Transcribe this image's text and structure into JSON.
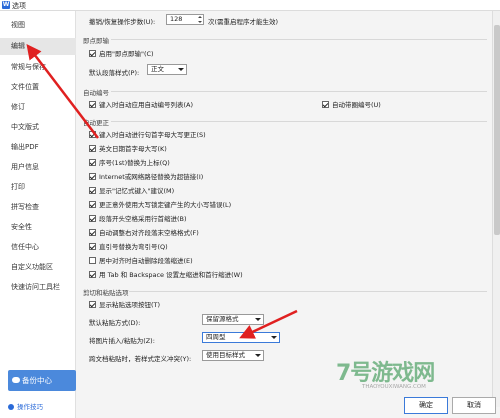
{
  "window": {
    "title": "选项"
  },
  "sidebar": {
    "items": [
      {
        "label": "视图"
      },
      {
        "label": "编辑"
      },
      {
        "label": "常规与保存"
      },
      {
        "label": "文件位置"
      },
      {
        "label": "修订"
      },
      {
        "label": "中文版式"
      },
      {
        "label": "输出PDF"
      },
      {
        "label": "用户信息"
      },
      {
        "label": "打印"
      },
      {
        "label": "拼写检查"
      },
      {
        "label": "安全性"
      },
      {
        "label": "信任中心"
      },
      {
        "label": "自定义功能区"
      },
      {
        "label": "快速访问工具栏"
      }
    ],
    "backup_label": "备份中心",
    "tips_label": "操作技巧"
  },
  "top_row": {
    "label": "撤销/恢复操作步数(U):",
    "value": "128",
    "hint": "次(需重启程序才能生效)"
  },
  "immediate_format": {
    "title": "即点即输",
    "enable_label": "启用\"即点即输\"(C)",
    "default_style_label": "默认段落样式(P):",
    "default_style_value": "正文"
  },
  "numbering": {
    "title": "自动编号",
    "auto_list_label": "键入时自动应用自动编号列表(A)",
    "auto_cross_label": "自动带圈编号(U)"
  },
  "autocorrect": {
    "title": "自动更正",
    "items": [
      {
        "label": "键入时自动进行句首字母大写更正(S)"
      },
      {
        "label": "英文日期首字母大写(K)"
      },
      {
        "label": "序号(1st)替换为上标(Q)"
      },
      {
        "label": "Internet或网络路径替换为超链接(I)"
      },
      {
        "label": "显示\"记忆式键入\"建议(M)"
      },
      {
        "label": "更正意外使用大写锁定键产生的大小写错误(L)"
      },
      {
        "label": "段落开头空格采用行首缩进(B)"
      },
      {
        "label": "自动调整右对齐段落末空格格式(F)"
      },
      {
        "label": "直引号替换为弯引号(Q)"
      },
      {
        "label": "居中对齐时自动删除段落缩进(E)"
      },
      {
        "label": "用 Tab 和 Backspace 设置左缩进和首行缩进(W)"
      }
    ]
  },
  "paste": {
    "title": "剪切和粘贴选项",
    "show_button_label": "显示粘贴选项按钮(T)",
    "default_paste_label": "默认粘贴方式(D):",
    "default_paste_value": "保留源格式",
    "image_insert_label": "将图片插入/粘贴为(Z):",
    "image_insert_value": "四周型",
    "cross_doc_label": "跨文档粘贴时，若样式定义冲突(Y):",
    "cross_doc_value": "使用目标样式"
  },
  "footer": {
    "ok_label": "确定",
    "cancel_label": "取消"
  },
  "watermark": {
    "main": "7号游戏网",
    "sub": "THAOYOUXIWANG.COM"
  },
  "colors": {
    "accent": "#4b89dc",
    "arrow": "#e02020"
  }
}
